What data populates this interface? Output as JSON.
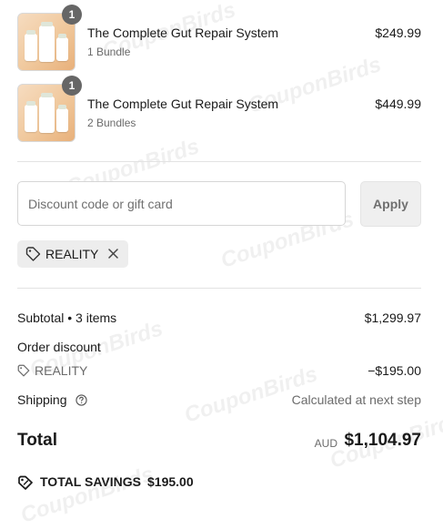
{
  "watermark": "CouponBirds",
  "cart": {
    "items": [
      {
        "quantity": "1",
        "title": "The Complete Gut Repair System",
        "variant": "1 Bundle",
        "price": "$249.99"
      },
      {
        "quantity": "1",
        "title": "The Complete Gut Repair System",
        "variant": "2 Bundles",
        "price": "$449.99"
      }
    ]
  },
  "discount": {
    "placeholder": "Discount code or gift card",
    "apply_label": "Apply",
    "applied_code": "REALITY"
  },
  "summary": {
    "subtotal_label": "Subtotal • 3 items",
    "subtotal_value": "$1,299.97",
    "order_discount_label": "Order discount",
    "discount_code": "REALITY",
    "discount_value": "−$195.00",
    "shipping_label": "Shipping",
    "shipping_value": "Calculated at next step",
    "total_label": "Total",
    "currency": "AUD",
    "total_value": "$1,104.97",
    "savings_label": "TOTAL SAVINGS",
    "savings_value": "$195.00"
  },
  "icons": {
    "tag": "tag-icon",
    "remove": "close-icon",
    "help": "question-circle-icon",
    "savings": "savings-tag-icon"
  }
}
